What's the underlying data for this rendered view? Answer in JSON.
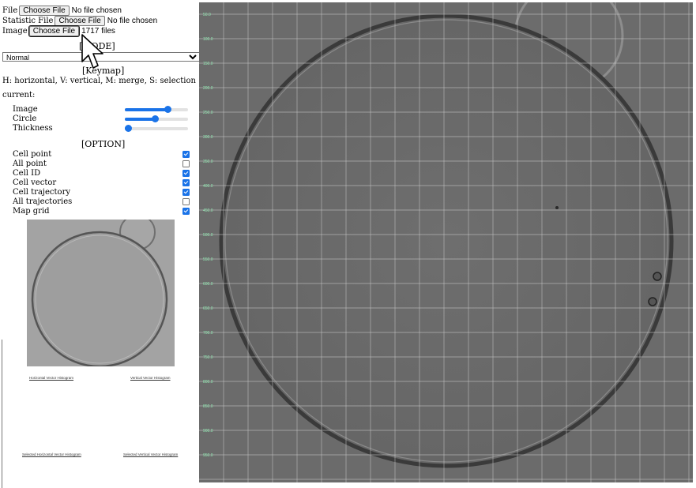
{
  "inputs": {
    "file": {
      "label": "File",
      "button": "Choose File",
      "status": "No file chosen"
    },
    "statistic_file": {
      "label": "Statistic File",
      "button": "Choose File",
      "status": "No file chosen"
    },
    "image": {
      "label": "Image",
      "button": "Choose File",
      "status": "1717 files"
    }
  },
  "mode": {
    "header": "[MODE]",
    "selected": "Normal"
  },
  "keymap": {
    "header": "[Keymap]",
    "text": "H: horizontal, V: vertical, M: merge, S: selection"
  },
  "current_label": "current:",
  "sliders": [
    {
      "label": "Image",
      "value": 0.68
    },
    {
      "label": "Circle",
      "value": 0.47
    },
    {
      "label": "Thickness",
      "value": 0.05
    }
  ],
  "option": {
    "header": "[OPTION]",
    "items": [
      {
        "label": "Cell point",
        "checked": true
      },
      {
        "label": "All point",
        "checked": false
      },
      {
        "label": "Cell ID",
        "checked": true
      },
      {
        "label": "Cell vector",
        "checked": true
      },
      {
        "label": "Cell trajectory",
        "checked": true
      },
      {
        "label": "All trajectories",
        "checked": false
      },
      {
        "label": "Map grid",
        "checked": true
      }
    ]
  },
  "histograms": {
    "horizontal": "Horizontal Vector Histogram",
    "vertical": "Vertical Vector Histogram",
    "selected_horizontal": "Selected Horizontal Vector Histogram",
    "selected_vertical": "Selected Vertical Vector Histogram"
  },
  "main_view": {
    "y_labels": [
      "50.0",
      "100.0",
      "150.0",
      "200.0",
      "250.0",
      "300.0",
      "350.0",
      "400.0",
      "450.0",
      "500.0",
      "550.0",
      "600.0",
      "650.0",
      "700.0",
      "750.0",
      "800.0",
      "850.0",
      "900.0",
      "950.0"
    ],
    "grid_color": "#c8c8c8",
    "label_color": "#8fe8b0"
  },
  "icons": {
    "cursor": "hand-pointer-cursor-icon"
  }
}
